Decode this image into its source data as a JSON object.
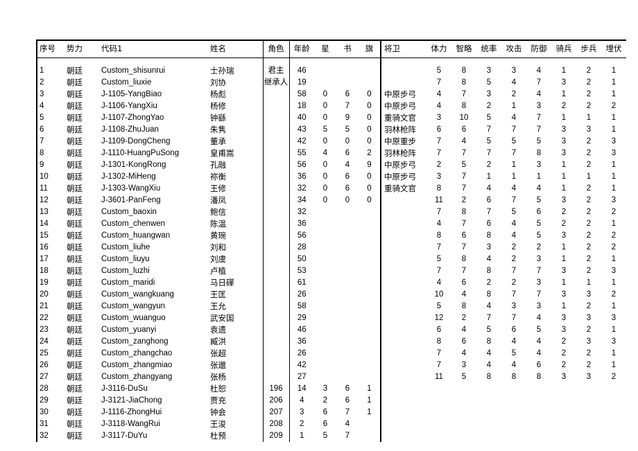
{
  "table": {
    "columns": [
      {
        "key": "idx",
        "label": "序号"
      },
      {
        "key": "faction",
        "label": "势力"
      },
      {
        "key": "code",
        "label": "代码1"
      },
      {
        "key": "name",
        "label": "姓名"
      },
      {
        "key": "role",
        "label": "角色"
      },
      {
        "key": "age",
        "label": "年龄"
      },
      {
        "key": "star",
        "label": "星"
      },
      {
        "key": "book",
        "label": "书"
      },
      {
        "key": "flag",
        "label": "旗"
      },
      {
        "key": "unit",
        "label": "将卫"
      },
      {
        "key": "hp",
        "label": "体力"
      },
      {
        "key": "int",
        "label": "智略"
      },
      {
        "key": "cmd",
        "label": "统率"
      },
      {
        "key": "atk",
        "label": "攻击"
      },
      {
        "key": "def",
        "label": "防御"
      },
      {
        "key": "cav",
        "label": "骑兵"
      },
      {
        "key": "inf",
        "label": "步兵"
      },
      {
        "key": "amb",
        "label": "埋伏"
      }
    ],
    "rows": [
      {
        "idx": "1",
        "faction": "朝廷",
        "code": "Custom_shisunrui",
        "name": "士孙瑞",
        "role": "君主",
        "age": "46",
        "star": "",
        "book": "",
        "flag": "",
        "unit": "",
        "hp": "5",
        "int": "8",
        "cmd": "3",
        "atk": "3",
        "def": "4",
        "cav": "1",
        "inf": "2",
        "amb": "1"
      },
      {
        "idx": "2",
        "faction": "朝廷",
        "code": "Custom_liuxie",
        "name": "刘协",
        "role": "继承人",
        "age": "19",
        "star": "",
        "book": "",
        "flag": "",
        "unit": "",
        "hp": "7",
        "int": "8",
        "cmd": "5",
        "atk": "4",
        "def": "7",
        "cav": "3",
        "inf": "2",
        "amb": "1"
      },
      {
        "idx": "3",
        "faction": "朝廷",
        "code": "J-1105-YangBiao",
        "name": "杨彪",
        "role": "",
        "age": "58",
        "star": "0",
        "book": "6",
        "flag": "0",
        "unit": "中原步弓",
        "hp": "4",
        "int": "7",
        "cmd": "3",
        "atk": "2",
        "def": "4",
        "cav": "1",
        "inf": "2",
        "amb": "1"
      },
      {
        "idx": "4",
        "faction": "朝廷",
        "code": "J-1106-YangXiu",
        "name": "杨修",
        "role": "",
        "age": "18",
        "star": "0",
        "book": "7",
        "flag": "0",
        "unit": "中原步弓",
        "hp": "4",
        "int": "8",
        "cmd": "2",
        "atk": "1",
        "def": "3",
        "cav": "2",
        "inf": "2",
        "amb": "2"
      },
      {
        "idx": "5",
        "faction": "朝廷",
        "code": "J-1107-ZhongYao",
        "name": "钟繇",
        "role": "",
        "age": "40",
        "star": "0",
        "book": "9",
        "flag": "0",
        "unit": "重骑文官",
        "hp": "3",
        "int": "10",
        "cmd": "5",
        "atk": "4",
        "def": "7",
        "cav": "1",
        "inf": "1",
        "amb": "1"
      },
      {
        "idx": "6",
        "faction": "朝廷",
        "code": "J-1108-ZhuJuan",
        "name": "朱隽",
        "role": "",
        "age": "43",
        "star": "5",
        "book": "5",
        "flag": "0",
        "unit": "羽林枪阵",
        "hp": "6",
        "int": "6",
        "cmd": "7",
        "atk": "7",
        "def": "7",
        "cav": "3",
        "inf": "3",
        "amb": "1"
      },
      {
        "idx": "7",
        "faction": "朝廷",
        "code": "J-1109-DongCheng",
        "name": "董承",
        "role": "",
        "age": "42",
        "star": "0",
        "book": "0",
        "flag": "0",
        "unit": "中原重步",
        "hp": "7",
        "int": "4",
        "cmd": "5",
        "atk": "5",
        "def": "5",
        "cav": "3",
        "inf": "2",
        "amb": "3"
      },
      {
        "idx": "8",
        "faction": "朝廷",
        "code": "J-1110-HuangPuSong",
        "name": "皇甫嵩",
        "role": "",
        "age": "55",
        "star": "4",
        "book": "6",
        "flag": "2",
        "unit": "羽林枪阵",
        "hp": "7",
        "int": "7",
        "cmd": "7",
        "atk": "7",
        "def": "8",
        "cav": "3",
        "inf": "2",
        "amb": "3"
      },
      {
        "idx": "9",
        "faction": "朝廷",
        "code": "J-1301-KongRong",
        "name": "孔融",
        "role": "",
        "age": "56",
        "star": "0",
        "book": "4",
        "flag": "9",
        "unit": "中原步弓",
        "hp": "2",
        "int": "5",
        "cmd": "2",
        "atk": "1",
        "def": "3",
        "cav": "1",
        "inf": "2",
        "amb": "1"
      },
      {
        "idx": "10",
        "faction": "朝廷",
        "code": "J-1302-MiHeng",
        "name": "祢衡",
        "role": "",
        "age": "36",
        "star": "0",
        "book": "6",
        "flag": "0",
        "unit": "中原步弓",
        "hp": "3",
        "int": "7",
        "cmd": "1",
        "atk": "1",
        "def": "1",
        "cav": "1",
        "inf": "1",
        "amb": "1"
      },
      {
        "idx": "11",
        "faction": "朝廷",
        "code": "J-1303-WangXiu",
        "name": "王修",
        "role": "",
        "age": "32",
        "star": "0",
        "book": "6",
        "flag": "0",
        "unit": "重骑文官",
        "hp": "8",
        "int": "7",
        "cmd": "4",
        "atk": "4",
        "def": "4",
        "cav": "1",
        "inf": "2",
        "amb": "1"
      },
      {
        "idx": "12",
        "faction": "朝廷",
        "code": "J-3601-PanFeng",
        "name": "潘凤",
        "role": "",
        "age": "34",
        "star": "0",
        "book": "0",
        "flag": "0",
        "unit": "",
        "hp": "11",
        "int": "2",
        "cmd": "6",
        "atk": "7",
        "def": "5",
        "cav": "3",
        "inf": "2",
        "amb": "3"
      },
      {
        "idx": "13",
        "faction": "朝廷",
        "code": "Custom_baoxin",
        "name": "鲍信",
        "role": "",
        "age": "32",
        "star": "",
        "book": "",
        "flag": "",
        "unit": "",
        "hp": "7",
        "int": "8",
        "cmd": "7",
        "atk": "5",
        "def": "6",
        "cav": "2",
        "inf": "2",
        "amb": "2"
      },
      {
        "idx": "14",
        "faction": "朝廷",
        "code": "Custom_chenwen",
        "name": "陈温",
        "role": "",
        "age": "36",
        "star": "",
        "book": "",
        "flag": "",
        "unit": "",
        "hp": "4",
        "int": "7",
        "cmd": "6",
        "atk": "4",
        "def": "5",
        "cav": "2",
        "inf": "2",
        "amb": "1"
      },
      {
        "idx": "15",
        "faction": "朝廷",
        "code": "Custom_huangwan",
        "name": "黄琬",
        "role": "",
        "age": "56",
        "star": "",
        "book": "",
        "flag": "",
        "unit": "",
        "hp": "8",
        "int": "6",
        "cmd": "8",
        "atk": "4",
        "def": "5",
        "cav": "3",
        "inf": "2",
        "amb": "2"
      },
      {
        "idx": "16",
        "faction": "朝廷",
        "code": "Custom_liuhe",
        "name": "刘和",
        "role": "",
        "age": "28",
        "star": "",
        "book": "",
        "flag": "",
        "unit": "",
        "hp": "7",
        "int": "7",
        "cmd": "3",
        "atk": "2",
        "def": "2",
        "cav": "1",
        "inf": "2",
        "amb": "2"
      },
      {
        "idx": "17",
        "faction": "朝廷",
        "code": "Custom_liuyu",
        "name": "刘虞",
        "role": "",
        "age": "50",
        "star": "",
        "book": "",
        "flag": "",
        "unit": "",
        "hp": "5",
        "int": "8",
        "cmd": "4",
        "atk": "2",
        "def": "3",
        "cav": "1",
        "inf": "2",
        "amb": "1"
      },
      {
        "idx": "18",
        "faction": "朝廷",
        "code": "Custom_luzhi",
        "name": "卢植",
        "role": "",
        "age": "53",
        "star": "",
        "book": "",
        "flag": "",
        "unit": "",
        "hp": "7",
        "int": "7",
        "cmd": "8",
        "atk": "7",
        "def": "7",
        "cav": "3",
        "inf": "2",
        "amb": "3"
      },
      {
        "idx": "19",
        "faction": "朝廷",
        "code": "Custom_maridi",
        "name": "马日磾",
        "role": "",
        "age": "61",
        "star": "",
        "book": "",
        "flag": "",
        "unit": "",
        "hp": "4",
        "int": "6",
        "cmd": "2",
        "atk": "2",
        "def": "3",
        "cav": "1",
        "inf": "1",
        "amb": "1"
      },
      {
        "idx": "20",
        "faction": "朝廷",
        "code": "Custom_wangkuang",
        "name": "王匡",
        "role": "",
        "age": "26",
        "star": "",
        "book": "",
        "flag": "",
        "unit": "",
        "hp": "10",
        "int": "4",
        "cmd": "8",
        "atk": "7",
        "def": "7",
        "cav": "3",
        "inf": "3",
        "amb": "2"
      },
      {
        "idx": "21",
        "faction": "朝廷",
        "code": "Custom_wangyun",
        "name": "王允",
        "role": "",
        "age": "58",
        "star": "",
        "book": "",
        "flag": "",
        "unit": "",
        "hp": "5",
        "int": "8",
        "cmd": "4",
        "atk": "3",
        "def": "3",
        "cav": "1",
        "inf": "2",
        "amb": "1"
      },
      {
        "idx": "22",
        "faction": "朝廷",
        "code": "Custom_wuanguo",
        "name": "武安国",
        "role": "",
        "age": "29",
        "star": "",
        "book": "",
        "flag": "",
        "unit": "",
        "hp": "12",
        "int": "2",
        "cmd": "7",
        "atk": "7",
        "def": "4",
        "cav": "3",
        "inf": "3",
        "amb": "3"
      },
      {
        "idx": "23",
        "faction": "朝廷",
        "code": "Custom_yuanyi",
        "name": "袁遗",
        "role": "",
        "age": "46",
        "star": "",
        "book": "",
        "flag": "",
        "unit": "",
        "hp": "6",
        "int": "4",
        "cmd": "5",
        "atk": "6",
        "def": "5",
        "cav": "3",
        "inf": "2",
        "amb": "1"
      },
      {
        "idx": "24",
        "faction": "朝廷",
        "code": "Custom_zanghong",
        "name": "臧洪",
        "role": "",
        "age": "36",
        "star": "",
        "book": "",
        "flag": "",
        "unit": "",
        "hp": "8",
        "int": "6",
        "cmd": "8",
        "atk": "4",
        "def": "4",
        "cav": "2",
        "inf": "3",
        "amb": "3"
      },
      {
        "idx": "25",
        "faction": "朝廷",
        "code": "Custom_zhangchao",
        "name": "张超",
        "role": "",
        "age": "26",
        "star": "",
        "book": "",
        "flag": "",
        "unit": "",
        "hp": "7",
        "int": "4",
        "cmd": "4",
        "atk": "5",
        "def": "4",
        "cav": "2",
        "inf": "2",
        "amb": "1"
      },
      {
        "idx": "26",
        "faction": "朝廷",
        "code": "Custom_zhangmiao",
        "name": "张邈",
        "role": "",
        "age": "42",
        "star": "",
        "book": "",
        "flag": "",
        "unit": "",
        "hp": "7",
        "int": "3",
        "cmd": "4",
        "atk": "4",
        "def": "6",
        "cav": "2",
        "inf": "2",
        "amb": "1"
      },
      {
        "idx": "27",
        "faction": "朝廷",
        "code": "Custom_zhangyang",
        "name": "张杨",
        "role": "",
        "age": "27",
        "star": "",
        "book": "",
        "flag": "",
        "unit": "",
        "hp": "11",
        "int": "5",
        "cmd": "8",
        "atk": "8",
        "def": "8",
        "cav": "3",
        "inf": "3",
        "amb": "2"
      },
      {
        "idx": "28",
        "faction": "朝廷",
        "code": "J-3116-DuSu",
        "name": "杜恕",
        "role": "196",
        "age": "14",
        "star": "3",
        "book": "6",
        "flag": "1",
        "unit": "",
        "hp": "",
        "int": "",
        "cmd": "",
        "atk": "",
        "def": "",
        "cav": "",
        "inf": "",
        "amb": ""
      },
      {
        "idx": "29",
        "faction": "朝廷",
        "code": "J-3121-JiaChong",
        "name": "贾充",
        "role": "206",
        "age": "4",
        "star": "2",
        "book": "6",
        "flag": "1",
        "unit": "",
        "hp": "",
        "int": "",
        "cmd": "",
        "atk": "",
        "def": "",
        "cav": "",
        "inf": "",
        "amb": ""
      },
      {
        "idx": "30",
        "faction": "朝廷",
        "code": "J-1116-ZhongHui",
        "name": "钟会",
        "role": "207",
        "age": "3",
        "star": "6",
        "book": "7",
        "flag": "1",
        "unit": "",
        "hp": "",
        "int": "",
        "cmd": "",
        "atk": "",
        "def": "",
        "cav": "",
        "inf": "",
        "amb": ""
      },
      {
        "idx": "31",
        "faction": "朝廷",
        "code": "J-3118-WangRui",
        "name": "王浚",
        "role": "208",
        "age": "2",
        "star": "6",
        "book": "4",
        "flag": "",
        "unit": "",
        "hp": "",
        "int": "",
        "cmd": "",
        "atk": "",
        "def": "",
        "cav": "",
        "inf": "",
        "amb": ""
      },
      {
        "idx": "32",
        "faction": "朝廷",
        "code": "J-3117-DuYu",
        "name": "杜预",
        "role": "209",
        "age": "1",
        "star": "5",
        "book": "7",
        "flag": "",
        "unit": "",
        "hp": "",
        "int": "",
        "cmd": "",
        "atk": "",
        "def": "",
        "cav": "",
        "inf": "",
        "amb": ""
      }
    ]
  }
}
